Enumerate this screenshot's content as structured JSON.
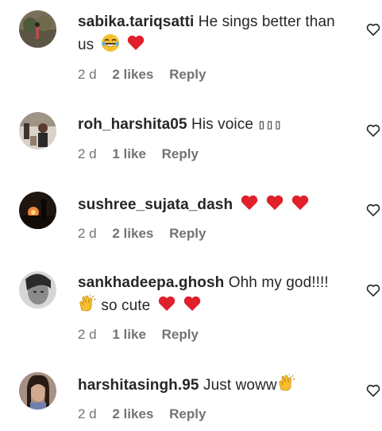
{
  "comments": [
    {
      "username": "sabika.tariqsatti",
      "text": "He sings better than us",
      "emoji": [
        "laughing-emoji",
        "red-heart-emoji"
      ],
      "time": "2 d",
      "likes": "2 likes",
      "reply": "Reply"
    },
    {
      "username": "roh_harshita05",
      "text": "His voice",
      "text_suffix": "▯▯▯",
      "emoji": [],
      "time": "2 d",
      "likes": "1 like",
      "reply": "Reply"
    },
    {
      "username": "sushree_sujata_dash",
      "text": "",
      "emoji": [
        "red-heart-emoji",
        "red-heart-emoji",
        "red-heart-emoji"
      ],
      "time": "2 d",
      "likes": "2 likes",
      "reply": "Reply"
    },
    {
      "username": "sankhadeepa.ghosh",
      "text": "Ohh my god!!!!",
      "text_line2": "so cute",
      "emoji": [
        "clapping-hands-emoji",
        "red-heart-emoji",
        "red-heart-emoji"
      ],
      "time": "2 d",
      "likes": "1 like",
      "reply": "Reply"
    },
    {
      "username": "harshitasingh.95",
      "text": "Just woww",
      "emoji": [
        "clapping-hands-emoji"
      ],
      "time": "2 d",
      "likes": "2 likes",
      "reply": "Reply"
    }
  ],
  "colors": {
    "text": "#262626",
    "meta": "#737373",
    "heart": "#e0202b",
    "clap": "#f7c02b"
  },
  "icons": {
    "like": "heart-outline-icon"
  }
}
